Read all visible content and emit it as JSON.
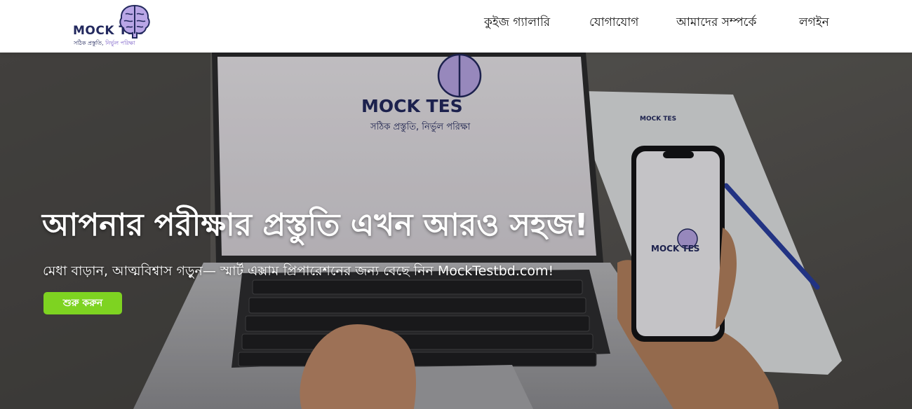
{
  "header": {
    "logo": {
      "name": "MOCK TES",
      "tagline_part1": "সঠিক প্রস্তুতি,",
      "tagline_part2": "নির্ভুল পরিক্ষা"
    },
    "nav": [
      {
        "label": "কুইজ গ্যালারি"
      },
      {
        "label": "যোগাযোগ"
      },
      {
        "label": "আমাদের সম্পর্কে"
      },
      {
        "label": "লগইন"
      }
    ]
  },
  "hero": {
    "title": "আপনার পরীক্ষার প্রস্তুতি এখন আরও সহজ!",
    "subtitle": "মেধা বাড়ান, আত্মবিশ্বাস গড়ুন— স্মার্ট এক্সাম প্রিপারেশনের জন্য বেছে নিন MockTestbd.com!",
    "cta_label": "শুরু করুন",
    "screen_logo": "MOCK TES",
    "screen_tagline": "সঠিক প্রস্তুতি, নির্ভুল পরিক্ষা",
    "phone_logo": "MOCK TES",
    "paper_logo": "MOCK TES"
  },
  "colors": {
    "brand_navy": "#23295e",
    "brand_purple": "#7b5fc7",
    "cta_green": "#7ed321"
  }
}
